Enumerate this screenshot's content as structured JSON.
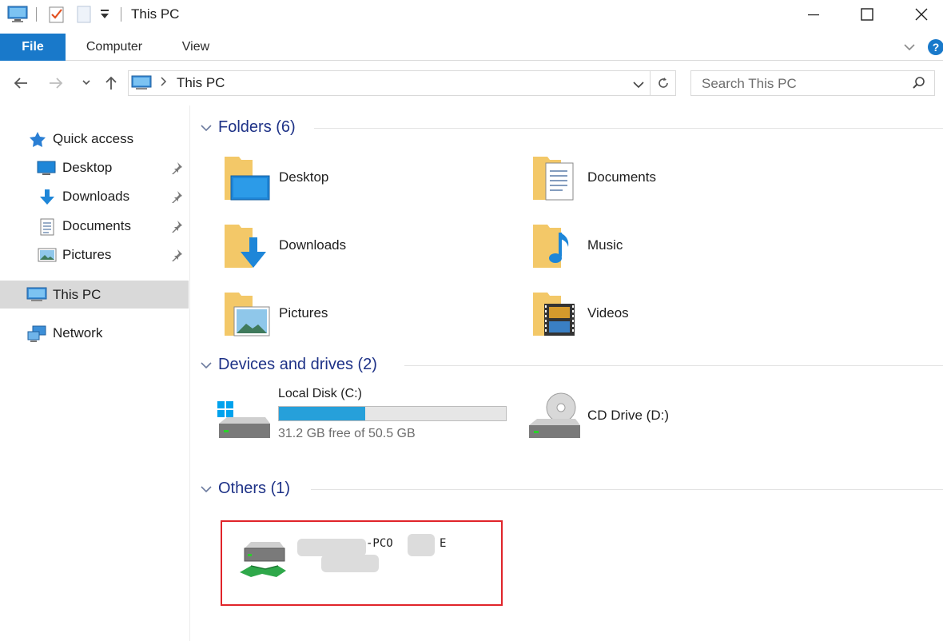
{
  "window": {
    "title": "This PC",
    "controls": {
      "minimize": "minimize",
      "maximize": "maximize",
      "close": "close"
    }
  },
  "ribbon": {
    "tabs": [
      "File",
      "Computer",
      "View"
    ]
  },
  "address": {
    "path": "This PC",
    "search_placeholder": "Search This PC"
  },
  "sidebar": {
    "quick_access": "Quick access",
    "items": [
      {
        "label": "Desktop",
        "icon": "desktop-icon",
        "pinned": true
      },
      {
        "label": "Downloads",
        "icon": "downloads-icon",
        "pinned": true
      },
      {
        "label": "Documents",
        "icon": "documents-icon",
        "pinned": true
      },
      {
        "label": "Pictures",
        "icon": "pictures-icon",
        "pinned": true
      }
    ],
    "this_pc": "This PC",
    "network": "Network"
  },
  "sections": {
    "folders": {
      "title": "Folders (6)",
      "items": [
        "Desktop",
        "Documents",
        "Downloads",
        "Music",
        "Pictures",
        "Videos"
      ]
    },
    "drives": {
      "title": "Devices and drives (2)",
      "local_disk": {
        "name": "Local Disk (C:)",
        "free_text": "31.2 GB free of 50.5 GB",
        "used_fraction": 0.38
      },
      "cd_drive": {
        "name": "CD Drive (D:)"
      }
    },
    "others": {
      "title": "Others (1)",
      "item_visible_text_1": "-PCO",
      "item_visible_text_2": "E"
    }
  },
  "colors": {
    "accent": "#1979ca",
    "section_title": "#1e3287",
    "progress": "#26a0da",
    "highlight": "#e0242a"
  }
}
